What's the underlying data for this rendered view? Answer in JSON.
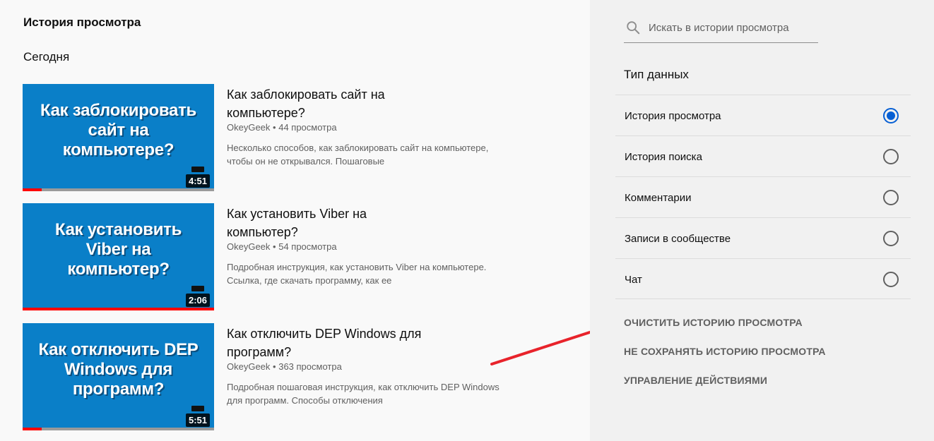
{
  "main": {
    "title": "История просмотра",
    "section": "Сегодня",
    "videos": [
      {
        "thumb_lines": [
          "Как заблокировать",
          "сайт на",
          "компьютере?"
        ],
        "duration": "4:51",
        "progress": 0.1,
        "title": "Как заблокировать сайт на компьютере?",
        "channel": "OkeyGeek",
        "views": "44 просмотра",
        "description": "Несколько способов, как заблокировать сайт на компьютере, чтобы он не открывался. Пошаговые"
      },
      {
        "thumb_lines": [
          "Как установить",
          "Viber на",
          "компьютер?"
        ],
        "duration": "2:06",
        "progress": 1.0,
        "title": "Как установить Viber на компьютер?",
        "channel": "OkeyGeek",
        "views": "54 просмотра",
        "description": "Подробная инструкция, как установить Viber на компьютере. Ссылка, где скачать программу, как ее"
      },
      {
        "thumb_lines": [
          "Как отключить DEP",
          "Windows для",
          "программ?"
        ],
        "duration": "5:51",
        "progress": 0.1,
        "title": "Как отключить DEP Windows для программ?",
        "channel": "OkeyGeek",
        "views": "363 просмотра",
        "description": "Подробная пошаговая инструкция, как отключить DEP Windows для программ. Способы отключения"
      }
    ]
  },
  "sidebar": {
    "search_placeholder": "Искать в истории просмотра",
    "type_title": "Тип данных",
    "options": [
      {
        "label": "История просмотра",
        "checked": true
      },
      {
        "label": "История поиска",
        "checked": false
      },
      {
        "label": "Комментарии",
        "checked": false
      },
      {
        "label": "Записи в сообществе",
        "checked": false
      },
      {
        "label": "Чат",
        "checked": false
      }
    ],
    "actions": {
      "clear": "ОЧИСТИТЬ ИСТОРИЮ ПРОСМОТРА",
      "pause": "НЕ СОХРАНЯТЬ ИСТОРИЮ ПРОСМОТРА",
      "manage": "УПРАВЛЕНИЕ ДЕЙСТВИЯМИ"
    }
  },
  "colors": {
    "thumb_bg": "#0a7fc8",
    "progress": "#ff0000",
    "radio_active": "#065fd4",
    "arrow": "#e8232b"
  },
  "icons": {
    "search": "search-icon",
    "arrow": "red-arrow-annotation"
  }
}
